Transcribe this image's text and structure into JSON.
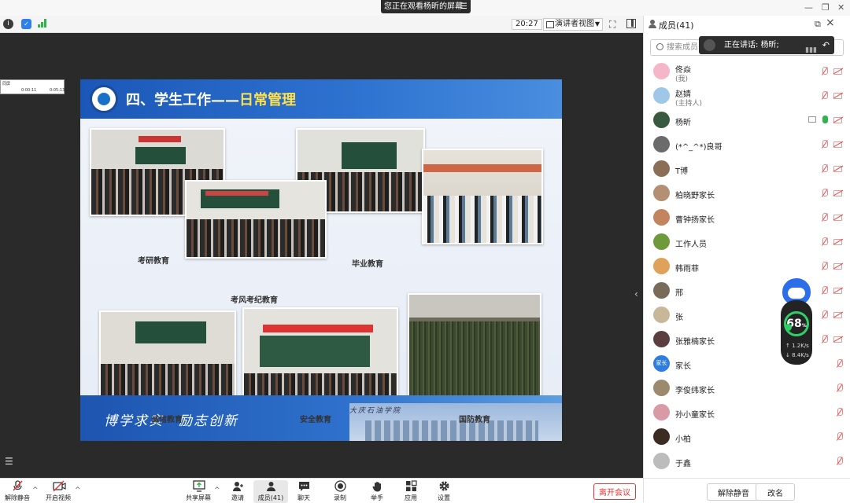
{
  "banner": {
    "text": "您正在观看杨昕的屏幕",
    "menu_icon": "menu-icon"
  },
  "window_controls": [
    "—",
    "❐",
    "✕"
  ],
  "meeting_bar": {
    "timer": "20:27",
    "view_mode": "演讲者视图",
    "icons": [
      "info-icon",
      "shield-icon",
      "signal-icon",
      "fullscreen-icon",
      "layout-icon"
    ]
  },
  "mini_video": {
    "label": "同屏",
    "time_left": "0:00:11",
    "time_right": "0:05:13"
  },
  "slide": {
    "title_main": "四、学生工作——",
    "title_highlight": "日常管理",
    "captions": {
      "kaoyan": "考研教育",
      "kaofeng": "考风考纪教育",
      "biye": "毕业教育",
      "chengxin": "诚信教育",
      "anquan": "安全教育",
      "guofang": "国防教育"
    },
    "motto": "博学求实　励志创新",
    "building_text": "大庆石油学院"
  },
  "panel": {
    "title": "成员(41)",
    "search_placeholder": "搜索成员",
    "speaking": "正在讲话: 杨昕;",
    "members": [
      {
        "name": "佟焱",
        "sub": "(我)",
        "avatar_color": "#f5b6c8",
        "mic": "muted",
        "cam": "off"
      },
      {
        "name": "赵婧",
        "sub": "(主持人)",
        "avatar_color": "#9ec7e8",
        "mic": "muted",
        "cam": "off"
      },
      {
        "name": "杨昕",
        "sub": "",
        "avatar_color": "#3a5a40",
        "mic": "on",
        "cam": "off",
        "sharing": true
      },
      {
        "name": "(*^_^*)良哥",
        "sub": "",
        "avatar_color": "#6b6b6b",
        "mic": "muted",
        "cam": "off"
      },
      {
        "name": "T博",
        "sub": "",
        "avatar_color": "#8a6e55",
        "mic": "muted",
        "cam": "off"
      },
      {
        "name": "柏晓野家长",
        "sub": "",
        "avatar_color": "#b58f73",
        "mic": "muted",
        "cam": "off"
      },
      {
        "name": "曹钟扬家长",
        "sub": "",
        "avatar_color": "#c2855e",
        "mic": "muted",
        "cam": "off"
      },
      {
        "name": "工作人员",
        "sub": "",
        "avatar_color": "#6f9a3c",
        "mic": "muted",
        "cam": "off"
      },
      {
        "name": "韩雨菲",
        "sub": "",
        "avatar_color": "#e0a25a",
        "mic": "muted",
        "cam": "off"
      },
      {
        "name": "邢",
        "sub": "",
        "avatar_color": "#7a6a5a",
        "mic": "muted",
        "cam": "off"
      },
      {
        "name": "张",
        "sub": "",
        "avatar_color": "#c9b79a",
        "mic": "muted",
        "cam": "off"
      },
      {
        "name": "张雅楠家长",
        "sub": "",
        "avatar_color": "#5b3f3f",
        "mic": "muted",
        "cam": "off"
      },
      {
        "name": "家长",
        "sub": "",
        "avatar_color": "#2f7de1",
        "avatar_text": "家长",
        "mic": "none",
        "cam": "off"
      },
      {
        "name": "李俊纬家长",
        "sub": "",
        "avatar_color": "#9c8a6e",
        "mic": "none",
        "cam": "off"
      },
      {
        "name": "孙小童家长",
        "sub": "",
        "avatar_color": "#d99aa6",
        "mic": "none",
        "cam": "off"
      },
      {
        "name": "小柏",
        "sub": "",
        "avatar_color": "#3b2b22",
        "mic": "none",
        "cam": "off"
      },
      {
        "name": "于鑫",
        "sub": "",
        "avatar_color": "#bcbcbc",
        "mic": "none",
        "cam": "off"
      }
    ],
    "footer": {
      "mute_all": "解除静音",
      "rename": "改名"
    }
  },
  "network": {
    "score": "68",
    "unit": "%",
    "upload": "1.2K/s",
    "download": "8.4K/s"
  },
  "controls": {
    "unmute": "解除静音",
    "start_video": "开启视频",
    "share_screen": "共享屏幕",
    "invite": "邀请",
    "participants": "成员(41)",
    "chat": "聊天",
    "record": "录制",
    "raise_hand": "举手",
    "apps": "应用",
    "settings": "设置",
    "leave": "离开会议"
  }
}
